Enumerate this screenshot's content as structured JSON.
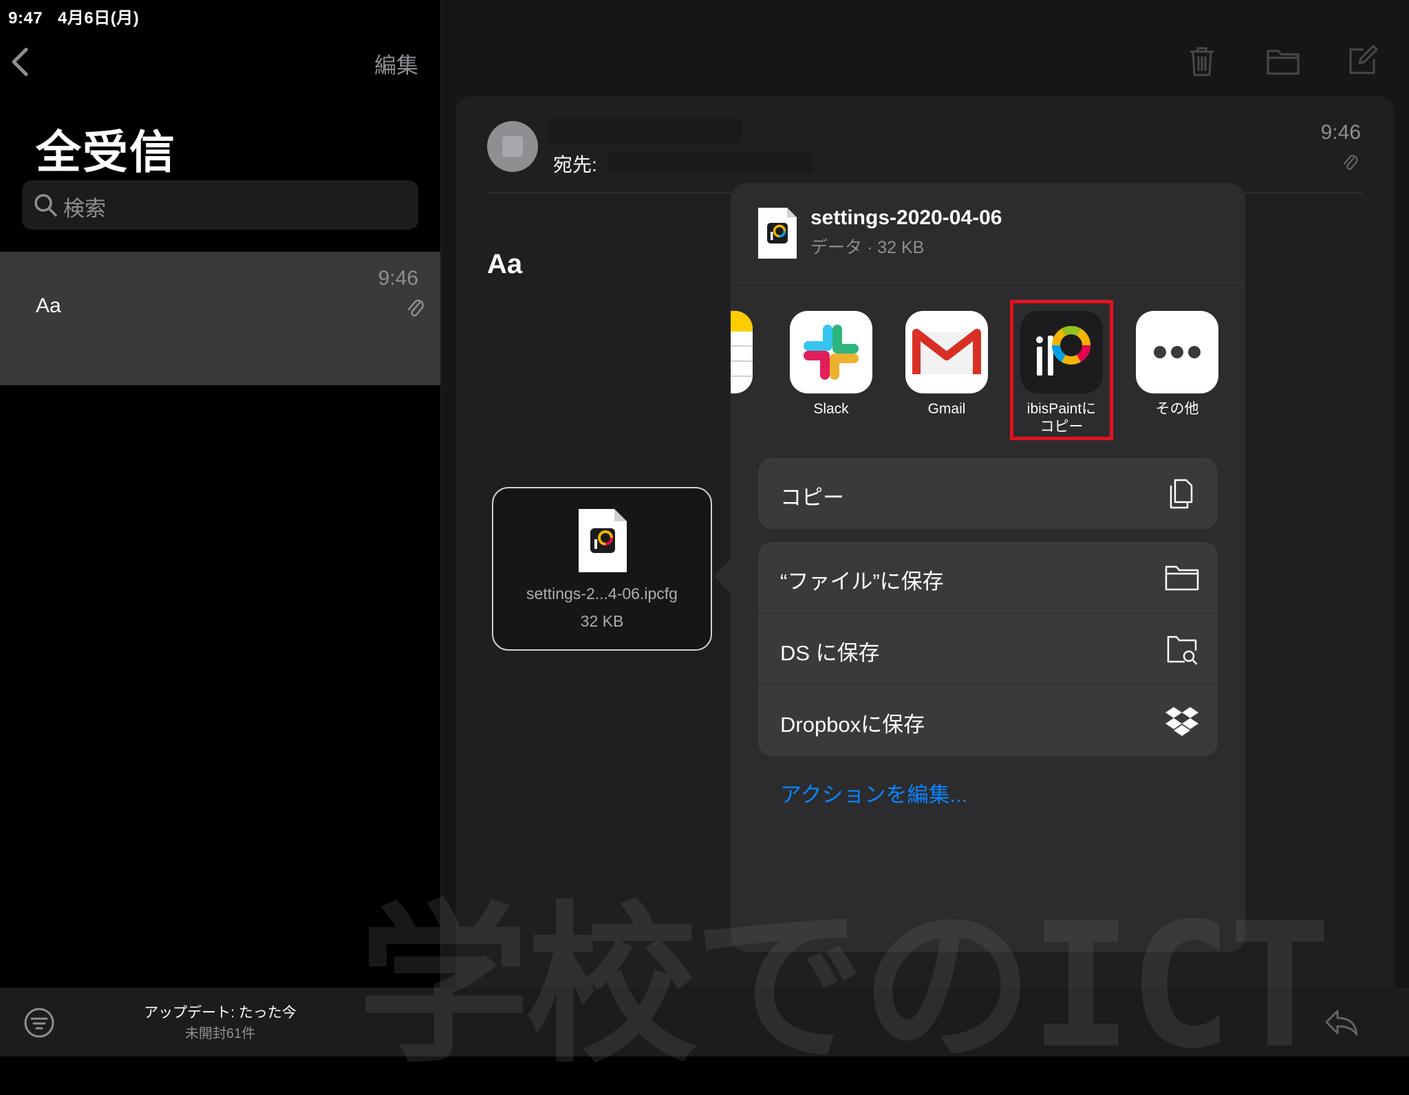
{
  "status_bar": {
    "time": "9:47",
    "date": "4月6日(月)"
  },
  "sidebar": {
    "edit_label": "編集",
    "title": "全受信",
    "search_placeholder": "検索",
    "mail_items": [
      {
        "time": "9:46",
        "subject": "Aa",
        "has_attachment": true
      }
    ],
    "footer": {
      "update_status": "アップデート: たった今",
      "unread": "未開封61件"
    }
  },
  "toolbar": {
    "icons": [
      "trash-icon",
      "folder-icon",
      "compose-icon"
    ]
  },
  "message": {
    "to_label": "宛先:",
    "time": "9:46",
    "subject": "Aa",
    "attachment": {
      "name": "settings-2...4-06.ipcfg",
      "size": "32 KB"
    }
  },
  "share_sheet": {
    "file_title": "settings-2020-04-06",
    "file_sub": "データ · 32 KB",
    "apps": [
      {
        "label": "Slack",
        "icon": "slack-icon"
      },
      {
        "label": "Gmail",
        "icon": "gmail-icon"
      },
      {
        "label": "ibisPaintにコピー",
        "icon": "ibispaint-icon",
        "highlighted": true
      },
      {
        "label": "その他",
        "icon": "more-icon"
      }
    ],
    "actions_group1": [
      {
        "label": "コピー",
        "icon": "copy-icon"
      }
    ],
    "actions_group2": [
      {
        "label": "“ファイル”に保存",
        "icon": "folder-icon"
      },
      {
        "label": "DS に保存",
        "icon": "folder-search-icon"
      },
      {
        "label": "Dropboxに保存",
        "icon": "dropbox-icon"
      }
    ],
    "edit_actions": "アクションを編集..."
  },
  "watermark": "学校でのICT",
  "colors": {
    "accent": "#0a84ff",
    "highlight": "#e3121f",
    "background": "#000000"
  }
}
